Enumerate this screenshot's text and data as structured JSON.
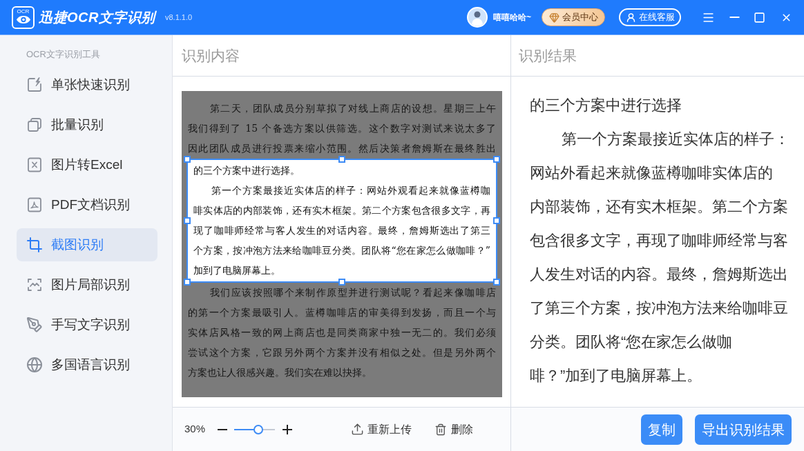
{
  "header": {
    "logo_text": "OCR",
    "app_title": "迅捷OCR文字识别",
    "version": "v8.1.1.0",
    "user_name": "嘻嘻哈哈~",
    "vip_button": "会员中心",
    "service_button": "在线客服"
  },
  "sidebar": {
    "title": "OCR文字识别工具",
    "items": [
      {
        "label": "单张快速识别",
        "selected": false
      },
      {
        "label": "批量识别",
        "selected": false
      },
      {
        "label": "图片转Excel",
        "selected": false
      },
      {
        "label": "PDF文档识别",
        "selected": false
      },
      {
        "label": "截图识别",
        "selected": true
      },
      {
        "label": "图片局部识别",
        "selected": false
      },
      {
        "label": "手写文字识别",
        "selected": false
      },
      {
        "label": "多国语言识别",
        "selected": false
      }
    ]
  },
  "source_panel": {
    "title": "识别内容",
    "document_lines": [
      {
        "text": "第二天，团队成员分别草拟了对线上商店的设想。星期三上午",
        "indent": true,
        "selected": false
      },
      {
        "text": "我们得到了 15 个备选方案以供筛选。这个数字对测试来说太多了",
        "indent": false,
        "selected": false
      },
      {
        "text": "因此团队成员进行投票来缩小范围。然后决策者詹姆斯在最终胜出",
        "indent": false,
        "selected": false
      },
      {
        "text": "的三个方案中进行选择。",
        "indent": false,
        "selected": true
      },
      {
        "text": "第一个方案最接近实体店的样子：网站外观看起来就像蓝樽咖",
        "indent": true,
        "selected": true
      },
      {
        "text": "啡实体店的内部装饰，还有实木框架。第二个方案包含很多文字，再",
        "indent": false,
        "selected": true
      },
      {
        "text": "现了咖啡师经常与客人发生的对话内容。最终，詹姆斯选出了第三",
        "indent": false,
        "selected": true
      },
      {
        "text": "个方案，按冲泡方法来给咖啡豆分类。团队将“您在家怎么做咖啡？”",
        "indent": false,
        "selected": true
      },
      {
        "text": "加到了电脑屏幕上。",
        "indent": false,
        "selected": true
      },
      {
        "text": "我们应该按照哪个来制作原型并进行测试呢？看起来像咖啡店",
        "indent": true,
        "selected": false
      },
      {
        "text": "的第一个方案最吸引人。蓝樽咖啡店的审美得到发扬，而且一个与",
        "indent": false,
        "selected": false
      },
      {
        "text": "实体店风格一致的网上商店也是同类商家中独一无二的。我们必须",
        "indent": false,
        "selected": false
      },
      {
        "text": "尝试这个方案，它跟另外两个方案并没有相似之处。但是另外两个",
        "indent": false,
        "selected": false
      },
      {
        "text": "方案也让人很感兴趣。我们实在难以抉择。",
        "indent": false,
        "selected": false
      }
    ],
    "zoom": {
      "reading": "30%",
      "level": 0.59
    },
    "actions": [
      "重新上传",
      "删除"
    ]
  },
  "result_panel": {
    "title": "识别结果",
    "paragraphs": [
      {
        "indent": false,
        "lines": [
          "的三个方案中进行选择"
        ]
      },
      {
        "indent": true,
        "lines": [
          "第一个方案最接近实体店的样子：",
          "网站外看起来就像蓝樽咖啡实体店的",
          "内部装饰，还有实木框架。第二个方案",
          "包含很多文字，再现了咖啡师经常与客",
          "人发生对话的内容。最终，詹姆斯选出",
          "了第三个方案，按冲泡方法来给咖啡豆",
          "分类。团队将“您在家怎么做咖",
          "啡？”加到了电脑屏幕上。"
        ]
      }
    ],
    "buttons": [
      "复制",
      "导出识别结果"
    ]
  }
}
